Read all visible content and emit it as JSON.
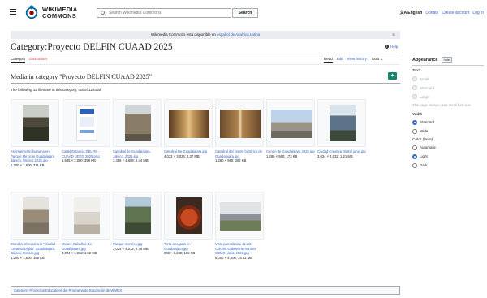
{
  "header": {
    "logo_line1": "WIKIMEDIA",
    "logo_line2": "COMMONS",
    "search_placeholder": "Search Wikimedia Commons",
    "search_button": "Search",
    "language": "English",
    "links": [
      "Donate",
      "Create account",
      "Log in"
    ]
  },
  "banner": {
    "text_before": "Wikimedia Commons está disponible en ",
    "link": "español de América Latina",
    "close": "⊗"
  },
  "page": {
    "title": "Category:Proyecto DELFIN CUAAD 2025",
    "help": "Help",
    "tabs_left": [
      "Category",
      "Discussion"
    ],
    "tabs_right": [
      "Read",
      "Edit",
      "View history",
      "Tools"
    ],
    "section_heading": "Media in category \"Proyecto DELFIN CUAAD 2025\"",
    "count_text": "The following 12 files are in this category, out of 12 total.",
    "add_symbol": "+"
  },
  "files": [
    {
      "name": "Asentamiento humano en Parque Mexicas Guadalajara Jalisco, Mexico 2025.jpg",
      "meta": "1,200 × 1,600; 311 KB"
    },
    {
      "name": "Cartel Estancia DELFIN - CUAAD UDEG 2025.png",
      "meta": "1,545 × 2,000; 358 KB"
    },
    {
      "name": "Catedral de Guadalajara, Jalisco, 2025.jpg",
      "meta": "3,456 × 4,608; 2.44 MB"
    },
    {
      "name": "Catedral De Guadalajara.jpg",
      "meta": "4,032 × 3,024; 2.37 MB"
    },
    {
      "name": "Catedral del centro histórico de Guadalajara.jpg",
      "meta": "1,280 × 960; 202 KB"
    },
    {
      "name": "Centro de Guadalajara 2025.jpg",
      "meta": "1,280 × 960; 173 KB"
    },
    {
      "name": "Ciudad Creativa Digital junio.jpg",
      "meta": "3,024 × 4,032; 1.21 MB"
    },
    {
      "name": "Entrada principal a la \"Ciudad Creativa Digital\" Guadalajara, Jalisco, Mexico.jpg",
      "meta": "1,200 × 1,600; 195 KB"
    },
    {
      "name": "Museo Cabañas De Guadalajara.jpg",
      "meta": "3,024 × 4,032; 1.52 MB"
    },
    {
      "name": "Parque morelos.jpg",
      "meta": "3,024 × 4,032; 2.76 MB"
    },
    {
      "name": "Torta ahogada en Guadalajara.jpg",
      "meta": "960 × 1,280; 195 KB"
    },
    {
      "name": "Vista panorámica desde Colonia Gabriel Hernández CDMX. Julio, 2023.jpg",
      "meta": "6,000 × 4,000; 13.62 MB"
    }
  ],
  "category_box": "Category: Proyectos Educativos del Programa de Educación de WMMX",
  "sidebar": {
    "title": "Appearance",
    "hide": "hide",
    "text_heading": "Text",
    "text_options": [
      "Small",
      "Standard",
      "Large"
    ],
    "text_note": "This page always uses small font size",
    "width_heading": "Width",
    "width_options": [
      "Standard",
      "Wide"
    ],
    "color_heading": "Color (beta)",
    "color_options": [
      "Automatic",
      "Light",
      "Dark"
    ]
  },
  "colors": {
    "link": "#3366cc",
    "discussion": "#dd3333",
    "add_button": "#14866d"
  }
}
